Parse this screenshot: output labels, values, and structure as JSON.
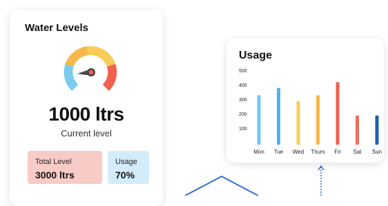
{
  "water_card": {
    "title": "Water Levels",
    "level_value": "1000 ltrs",
    "level_caption": "Current level",
    "total_label": "Total Level",
    "total_value": "3000 ltrs",
    "usage_label": "Usage",
    "usage_value": "70%",
    "gauge_icon": "gauge-icon",
    "colors": {
      "total_bg": "#f8cbc6",
      "usage_bg": "#d3ecfa"
    }
  },
  "usage_card": {
    "title": "Usage"
  },
  "chart_data": {
    "type": "bar",
    "title": "Usage",
    "categories": [
      "Mon",
      "Tue",
      "Wed",
      "Thurs",
      "Fri",
      "Sat",
      "Sun"
    ],
    "values": [
      330,
      380,
      290,
      330,
      420,
      190,
      190
    ],
    "yticks": [
      100,
      200,
      300,
      400,
      500
    ],
    "ylim": [
      0,
      500
    ],
    "grid": false,
    "colors": [
      "#74c6ef",
      "#4fb3ea",
      "#f9cc57",
      "#f6b84a",
      "#f2604e",
      "#ef6f59",
      "#1f5fae"
    ]
  }
}
